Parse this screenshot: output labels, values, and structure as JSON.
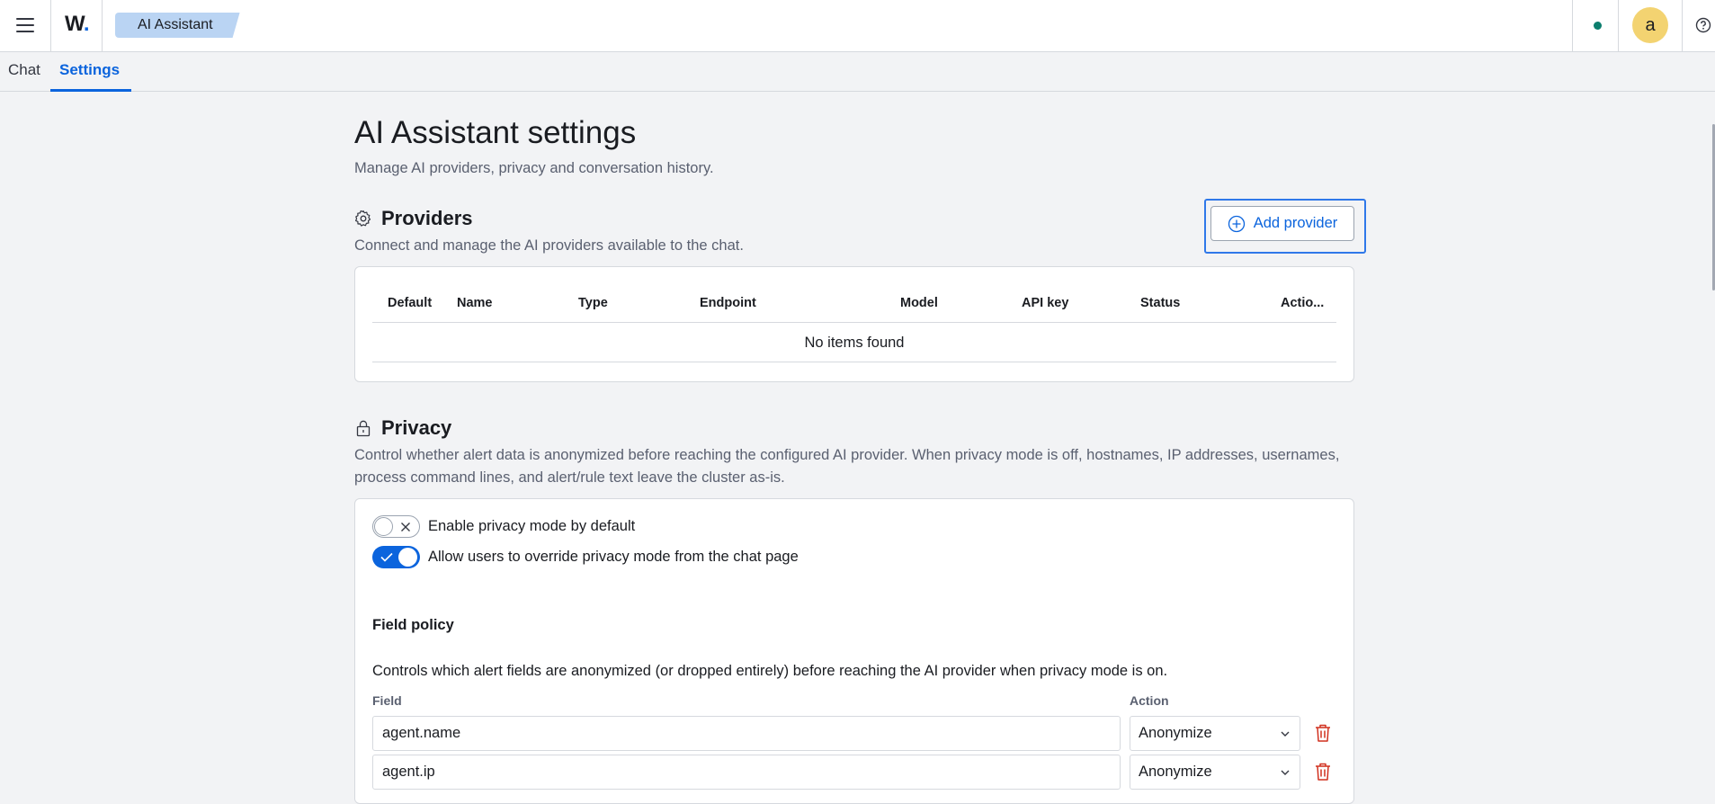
{
  "header": {
    "logo_text": "W",
    "logo_dot": ".",
    "breadcrumb": "AI Assistant",
    "avatar_letter": "a",
    "status_color": "#0c7e6e"
  },
  "tabs": [
    {
      "label": "Chat",
      "active": false
    },
    {
      "label": "Settings",
      "active": true
    }
  ],
  "page": {
    "title": "AI Assistant settings",
    "subtitle": "Manage AI providers, privacy and conversation history."
  },
  "providers": {
    "icon": "gear-icon",
    "title": "Providers",
    "description": "Connect and manage the AI providers available to the chat.",
    "add_button_label": "Add provider",
    "columns": [
      "Default",
      "Name",
      "Type",
      "Endpoint",
      "Model",
      "API key",
      "Status",
      "Actio..."
    ],
    "empty_message": "No items found"
  },
  "privacy": {
    "icon": "lock-icon",
    "title": "Privacy",
    "description": "Control whether alert data is anonymized before reaching the configured AI provider. When privacy mode is off, hostnames, IP addresses, usernames, process command lines, and alert/rule text leave the cluster as-is.",
    "toggles": [
      {
        "label": "Enable privacy mode by default",
        "enabled": false
      },
      {
        "label": "Allow users to override privacy mode from the chat page",
        "enabled": true
      }
    ],
    "field_policy": {
      "heading": "Field policy",
      "description": "Controls which alert fields are anonymized (or dropped entirely) before reaching the AI provider when privacy mode is on.",
      "field_column": "Field",
      "action_column": "Action",
      "rows": [
        {
          "field": "agent.name",
          "action": "Anonymize"
        },
        {
          "field": "agent.ip",
          "action": "Anonymize"
        }
      ]
    }
  }
}
